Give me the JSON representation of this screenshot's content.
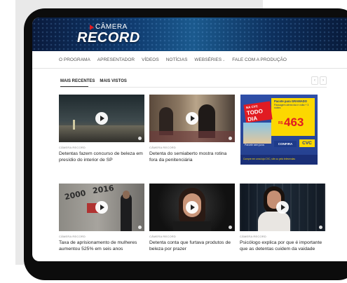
{
  "brand": {
    "top": "CÂMERA",
    "main": "RECORD",
    "accent": "#e11b22"
  },
  "nav": {
    "items": [
      "O PROGRAMA",
      "APRESENTADOR",
      "VÍDEOS",
      "NOTÍCIAS",
      "WEBSÉRIES",
      "FALE COM A PRODUÇÃO"
    ],
    "dropdown_icon": "chevron-down-icon"
  },
  "tabs": {
    "recent": "MAIS RECENTES",
    "most_viewed": "MAIS VISTOS"
  },
  "pager": {
    "prev": "‹",
    "next": "›"
  },
  "cards": [
    {
      "category": "CÂMERA RECORD",
      "title": "Detentas fazem concurso de beleza em presídio do interior de SP"
    },
    {
      "category": "CÂMERA RECORD",
      "title": "Detenta do semiaberto mostra rotina fora da penitenciária"
    },
    {
      "category": "CÂMERA RECORD",
      "title": "Taxa de aprisionamento de mulheres aumentou 525% em seis anos"
    },
    {
      "category": "CÂMERA RECORD",
      "title": "Detenta conta que furtava produtos de beleza por prazer"
    },
    {
      "category": "CÂMERA RECORD",
      "title": "Psicólogo explica por que é importante que as detentas cuidem da vaidade"
    }
  ],
  "thumb_text": {
    "year_a": "2000",
    "year_b": "2016"
  },
  "ad": {
    "headline": "Pacote para GRAMADO",
    "sub": "Passagem aérea ida e volta + 3 noites",
    "badge_a": "NA CVC",
    "badge_b": "TODO DIA",
    "currency": "R$",
    "price": "463",
    "installment": "Parcele sem juros",
    "button": "CONFIRA",
    "brand": "CVC",
    "footer": "Compre em uma loja CVC, site ou pelo televendas"
  }
}
